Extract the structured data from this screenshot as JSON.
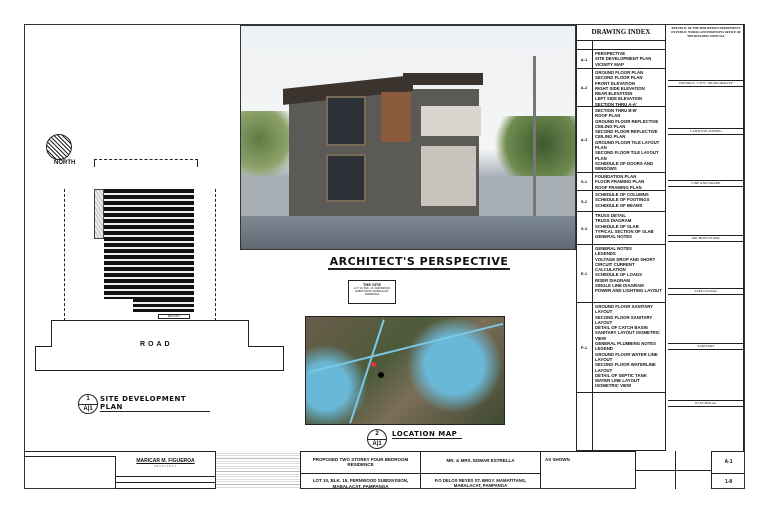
{
  "north_label": "NORTH",
  "site_plan": {
    "road_label": "ROAD",
    "title": "SITE DEVELOPMENT PLAN",
    "number": "1",
    "sheet": "A",
    "sheet_no": "1",
    "balcony": "BALCONY"
  },
  "perspective": {
    "title": "ARCHITECT'S PERSPECTIVE"
  },
  "location_map": {
    "title": "LOCATION MAP",
    "number": "2",
    "sheet": "A",
    "sheet_no": "1",
    "callout_title": "THE SITE",
    "callout_text": "LOT 10, BLK. 15, FERNWOOD SUBDIVISION, MABALACAT, PAMPANGA"
  },
  "drawing_index": {
    "title": "DRAWING INDEX",
    "rows": [
      {
        "code": "",
        "items": []
      },
      {
        "code": "A-1",
        "items": [
          "PERSPECTIVE",
          "SITE DEVELOPMENT PLAN",
          "VICINITY MAP"
        ]
      },
      {
        "code": "A-2",
        "items": [
          "GROUND FLOOR PLAN",
          "SECOND FLOOR PLAN",
          "FRONT ELEVATION",
          "RIGHT SIDE ELEVATION",
          "REAR ELEVATION",
          "LEFT SIDE ELEVATION",
          "SECTION THRU A-A'"
        ]
      },
      {
        "code": "A-3",
        "items": [
          "SECTION THRU B-B'",
          "ROOF PLAN",
          "GROUND FLOOR REFLECTIVE CEILING PLAN",
          "SECOND FLOOR REFLECTIVE CEILING PLAN",
          "GROUND FLOOR TILE LAYOUT PLAN",
          "SECOND FLOOR TILE LAYOUT PLAN",
          "SCHEDULE OF DOORS AND WINDOWS"
        ]
      },
      {
        "code": "S-1",
        "items": [
          "FOUNDATION PLAN",
          "FLOOR FRAMING PLAN",
          "ROOF FRAMING PLAN"
        ]
      },
      {
        "code": "S-2",
        "items": [
          "SCHEDULE OF COLUMNS",
          "SCHEDULE OF FOOTINGS",
          "SCHEDULE OF BEAMS"
        ]
      },
      {
        "code": "S-3",
        "items": [
          "TRUSS DETAIL",
          "TRUSS DIAGRAM",
          "SCHEDULE OF SLAB",
          "TYPICAL SECTION OF SLAB",
          "GENERAL NOTES"
        ]
      },
      {
        "code": "E-1",
        "items": [
          "GENERAL NOTES",
          "LEGENDS",
          "VOLTAGE DROP AND SHORT CIRCUIT CURRENT CALCULATION",
          "SCHEDULE OF LOADS",
          "RISER DIAGRAM",
          "SINGLE LINE DIAGRAM",
          "POWER AND LIGHTING LAYOUT"
        ]
      },
      {
        "code": "P-1",
        "items": [
          "GROUND FLOOR SANITARY LAYOUT",
          "SECOND FLOOR SANITARY LAYOUT",
          "DETAIL OF CATCH BASIN",
          "SANITARY LAYOUT ISOMETRIC VIEW",
          "GENERAL PLUMBING NOTES LEGEND",
          "GROUND FLOOR WATER LINE LAYOUT",
          "SECOND FLOOR WATERLINE LAYOUT",
          "DETAIL OF SEPTIC TANK",
          "WATER LINE LAYOUT ISOMETRIC VIEW"
        ]
      },
      {
        "code": "",
        "items": []
      }
    ]
  },
  "right_column": {
    "header": "REPUBLIC OF THE PHILIPPINES DEPARTMENT OF PUBLIC WORKS AND HIGHWAYS OFFICE OF THE BUILDING OFFICIAL",
    "labels": [
      "DISTRICT / CITY / MUNICIPALITY",
      "LAND USE ZONING",
      "LINE AND GRADE",
      "ARCHITECTURAL",
      "STRUCTURAL",
      "SANITARY",
      "ELECTRICAL"
    ]
  },
  "title_block": {
    "architect": "MARICAR M. FIGUEROA",
    "architect_role": "ARCHITECT",
    "project": "PROPOSED TWO STOREY FOUR BEDROOM RESIDENCE",
    "location": "LOT 10, BLK. 15, FERNWOOD SUBDIVISION, MABALACAT, PAMPANGA",
    "owner": "MR. & MRS. EDMAR ESTRELLA",
    "address": "P.O DELOS REYES ST. BRGY. MAMATITANG, MABALACAT, PAMPANGA",
    "scale": "AS SHOWN",
    "sheet_code": "A-1",
    "sheet_no": "1-8"
  }
}
